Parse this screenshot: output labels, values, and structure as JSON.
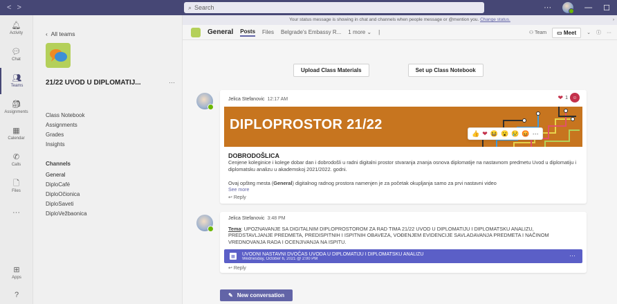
{
  "titlebar": {
    "back_arrow": "<",
    "forward_arrow": ">",
    "search_placeholder": "Search",
    "more": "···",
    "minimize": "—",
    "maximize": "☐",
    "close": "✕"
  },
  "rail": {
    "items": [
      {
        "label": "Activity",
        "icon": "bell-icon",
        "glyph": "🔔︎"
      },
      {
        "label": "Chat",
        "icon": "chat-icon",
        "glyph": "💬︎"
      },
      {
        "label": "Teams",
        "icon": "teams-icon",
        "glyph": "👥︎"
      },
      {
        "label": "Assignments",
        "icon": "assignments-icon",
        "glyph": "🎒︎"
      },
      {
        "label": "Calendar",
        "icon": "calendar-icon",
        "glyph": "▦"
      },
      {
        "label": "Calls",
        "icon": "phone-icon",
        "glyph": "✆"
      },
      {
        "label": "Files",
        "icon": "file-icon",
        "glyph": "🗋"
      },
      {
        "label": "",
        "icon": "more-apps-icon",
        "glyph": "···"
      }
    ],
    "apps_label": "Apps",
    "help_glyph": "?"
  },
  "teampanel": {
    "back_label": "All teams",
    "team_name": "21/22 UVOD U DIPLOMATIJ...",
    "more": "···",
    "items": [
      "Class Notebook",
      "Assignments",
      "Grades",
      "Insights"
    ],
    "channels_heading": "Channels",
    "channels": [
      "General",
      "DiploCafé",
      "DiploOčionica",
      "DiploSaveti",
      "DiploVežbaonica"
    ]
  },
  "banner": {
    "text": "Your status message is showing in chat and channels when people message or @mention you.",
    "link": "Change status."
  },
  "channel_header": {
    "title": "General",
    "tabs": [
      "Posts",
      "Files",
      "Belgrade's Embassy R...",
      "1 more ⌄"
    ],
    "team_label": "Team",
    "meet_label": "Meet",
    "info_glyph": "ⓘ",
    "more": "···"
  },
  "action_buttons": {
    "upload": "Upload Class Materials",
    "notebook": "Set up Class Notebook"
  },
  "post1": {
    "author": "Jelica Stefanovic",
    "time": "12:17 AM",
    "reaction_count": "1",
    "banner_title": "DIPLOPROSTOR 21/22",
    "heading": "DOBRODOŠLICA",
    "text1": "Cenjene koleginice i kolege dobar dan i dobrodošli u radni digitalni prostor stvaranja znanja osnova diplomatije na nastavnom predmetu Uvod u diplomatiju i diplomatsku analizu u akademskoj 2021/2022. godni.",
    "text2_pre": "Ovaj opšteg mesta (",
    "text2_bold": "General",
    "text2_post": ") digitalnog radnog prostora namenjen je za početak okupljanja samo za prvi nastavni video",
    "see_more": "See more",
    "reply": "Reply"
  },
  "reaction_bar": {
    "emojis": [
      "👍",
      "❤",
      "😆",
      "😮",
      "😢",
      "😡"
    ],
    "more": "···"
  },
  "post2": {
    "author": "Jelica Stefanovic",
    "time": "3:48 PM",
    "label": "Tema",
    "text": "UPOZNAVANJE SA DIGITALNIM DIPLOPROSTOROM ZA RAD TIMA 21/22 UVOD U DIPLOMATIJU I DIPLOMATSKU ANALIZU, PREDSTAVLJANJE PREDMETA, PREDISPITNIH I ISPITNIH OBAVEZA, VOĐENJEM EVIDENCIJE SAVLADAVANJA PREDMETA I NAČINOM VREDNOVANJA RADA I OCENJIVANJA NA ISPITU.",
    "event_title": "UVODNI NASTAVNI DVOČAS UVODA U DIPLOMATIJU I DIPLOMATSKU ANALIZU",
    "event_sub": "Wednesday, October 6, 2021 @ 2:00 PM",
    "event_more": "···",
    "reply": "Reply"
  },
  "new_conversation": "New conversation",
  "colors": {
    "titlebar": "#464775",
    "accent": "#6264a7",
    "event": "#5b5fc7",
    "banner_orange": "#c7751f"
  }
}
